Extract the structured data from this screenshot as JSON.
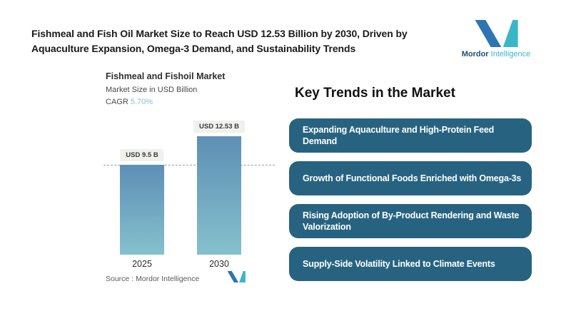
{
  "page": {
    "background": "#ffffff"
  },
  "header": {
    "title_line1": "Fishmeal and Fish Oil Market Size to Reach USD 12.53 Billion by 2030, Driven by",
    "title_line2": "Aquaculture Expansion, Omega-3 Demand, and Sustainability Trends"
  },
  "brand": {
    "logo_icon": "mordor-m-mark",
    "name_primary": "Mordor",
    "name_secondary": "Intelligence",
    "color_blue": "#2e75b2",
    "color_teal": "#3ab6c9"
  },
  "chart": {
    "title": "Fishmeal and Fishoil Market",
    "subtitle": "Market Size in USD Billion",
    "cagr_label": "CAGR ",
    "cagr_value": "5.70%",
    "cagr_value_color": "#8cbdd8",
    "source_text": "Source :  Mordor Intelligence"
  },
  "chart_data": {
    "type": "bar",
    "categories": [
      "2025",
      "2030"
    ],
    "values": [
      9.5,
      12.53
    ],
    "bar_value_labels": [
      "USD 9.5 B",
      "USD 12.53 B"
    ],
    "title": "Fishmeal and Fishoil Market",
    "ylabel": "Market Size in USD Billion",
    "cagr_percent": "5.70%",
    "ylim": [
      0,
      12.53
    ],
    "reference_line_at": 9.5,
    "reference_line_style": "dashed",
    "bar_gradient_top": "#5e8fb5",
    "bar_gradient_bottom": "#85c1cd",
    "grid": false,
    "legend": false
  },
  "trends": {
    "heading": "Key Trends in the Market",
    "box_color": "#276381",
    "text_color": "#ffffff",
    "items": [
      "Expanding Aquaculture and High-Protein Feed Demand",
      "Growth of Functional Foods Enriched with Omega-3s",
      "Rising Adoption of By-Product Rendering and Waste Valorization",
      "Supply-Side Volatility Linked to Climate Events"
    ]
  }
}
